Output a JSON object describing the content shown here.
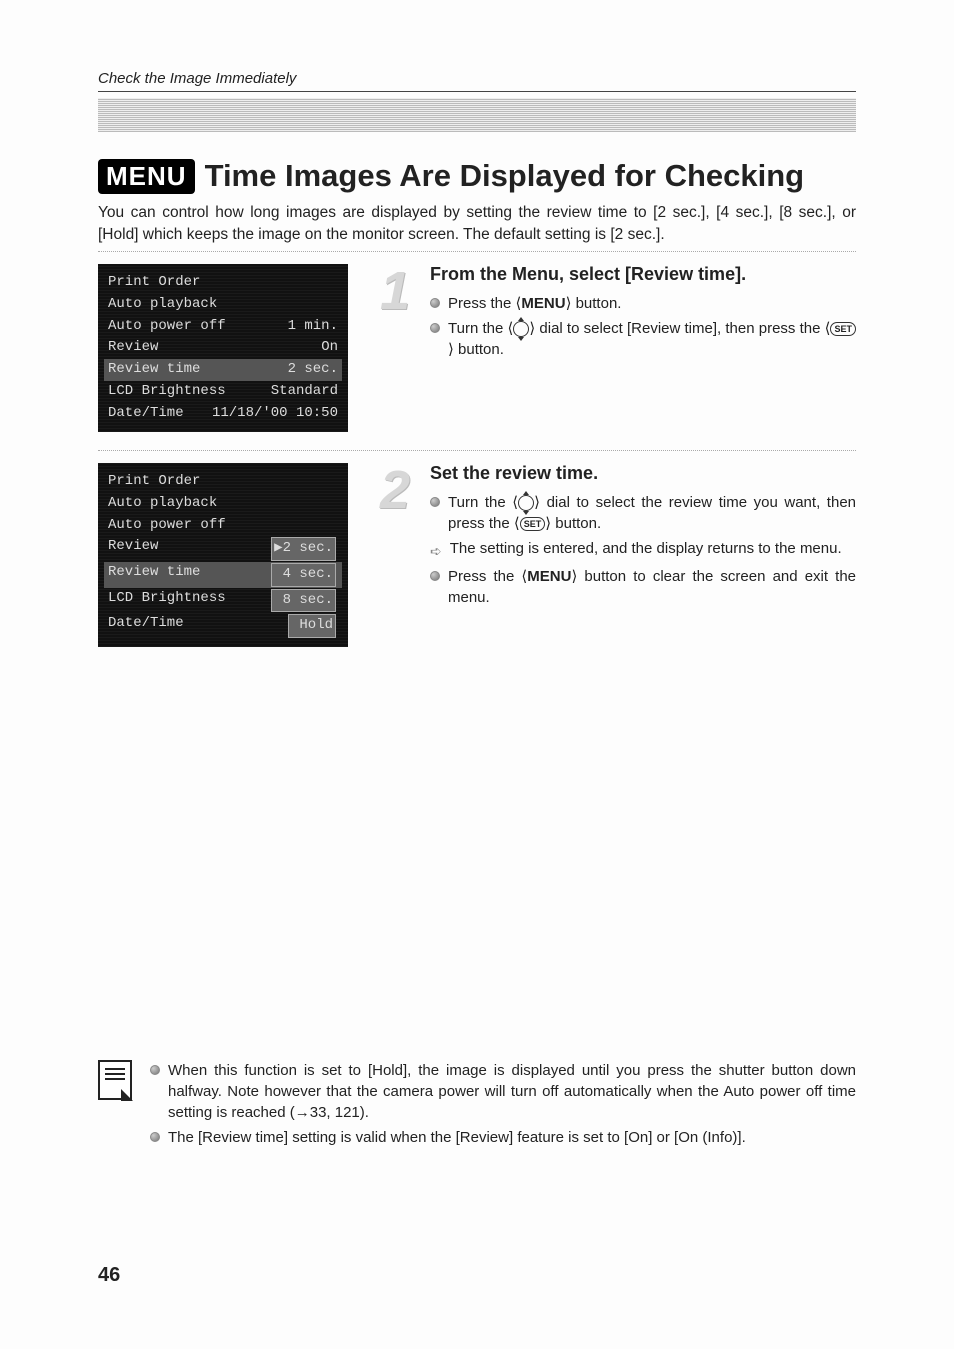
{
  "breadcrumb": "Check the Image Immediately",
  "menu_badge": "MENU",
  "title": "Time Images Are Displayed for Checking",
  "intro": "You can control how long images are displayed by setting the review time to [2 sec.], [4 sec.], [8 sec.], or [Hold] which keeps the image on the monitor screen. The default setting is [2 sec.].",
  "screen1": {
    "r1l": "Print Order",
    "r1r": "",
    "r2l": "Auto playback",
    "r2r": "",
    "r3l": "Auto power off",
    "r3r": "1 min.",
    "r4l": "Review",
    "r4r": "On",
    "r5l": "Review time",
    "r5r": "2 sec.",
    "r6l": "LCD Brightness",
    "r6r": "Standard",
    "r7l": "Date/Time",
    "r7r": "11/18/'00 10:50"
  },
  "screen2": {
    "r1l": "Print Order",
    "r1r": "",
    "r2l": "Auto playback",
    "r2r": "",
    "r3l": "Auto power off",
    "r3r": "",
    "r4l": "Review",
    "r4r": "▶2 sec.",
    "r5l": "Review time",
    "r5r": " 4 sec.",
    "r6l": "LCD Brightness",
    "r6r": " 8 sec.",
    "r7l": "Date/Time",
    "r7r": " Hold"
  },
  "step1": {
    "num": "1",
    "heading": "From the Menu, select [Review time].",
    "b1a": "Press the ⟨",
    "b1b": "MENU",
    "b1c": "⟩ button.",
    "b2a": "Turn the ⟨",
    "b2b": "⟩ dial to select [Review time], then press the ⟨",
    "b2c": "⟩ button.",
    "set": "SET"
  },
  "step2": {
    "num": "2",
    "heading": "Set the review time.",
    "b1a": "Turn the ⟨",
    "b1b": "⟩ dial to select the review time you want, then press the ⟨",
    "b1c": "⟩ button.",
    "b2": "The setting is entered, and the display returns to the menu.",
    "b3a": "Press the ⟨",
    "b3b": "MENU",
    "b3c": "⟩ button to clear the screen and exit the menu.",
    "set": "SET"
  },
  "notes": {
    "n1": "When this function is set to [Hold], the image is displayed until you press the shutter button down halfway. Note however that the camera power will turn off automatically when the Auto power off time setting is reached (→33, 121).",
    "n2": "The [Review time] setting is valid when the [Review] feature is set to [On] or [On (Info)]."
  },
  "page_number": "46"
}
